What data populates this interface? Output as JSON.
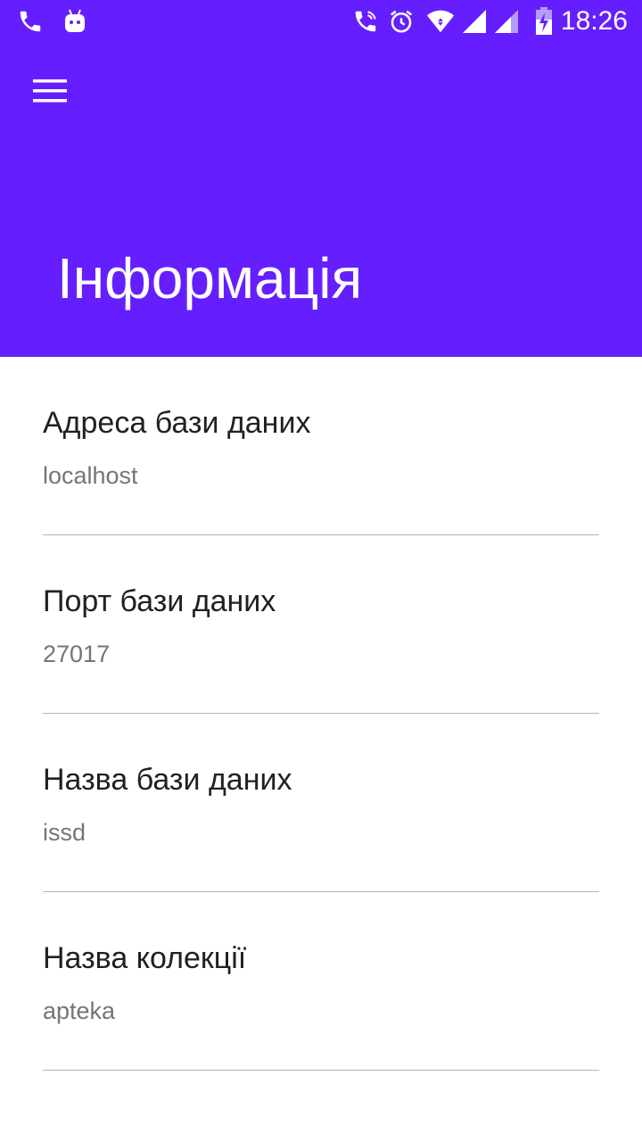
{
  "status_bar": {
    "time": "18:26",
    "icons": [
      "phone-icon",
      "android-notification-icon",
      "wifi-calling-icon",
      "alarm-icon",
      "wifi-icon",
      "cellular-signal-icon",
      "cellular-signal-secondary-icon",
      "battery-charging-icon"
    ]
  },
  "app_bar": {
    "menu_icon": "hamburger-menu-icon",
    "title": "Інформація",
    "color": "#651fff"
  },
  "items": [
    {
      "label": "Адреса бази даних",
      "value": "localhost"
    },
    {
      "label": "Порт бази даних",
      "value": "27017"
    },
    {
      "label": "Назва бази даних",
      "value": "issd"
    },
    {
      "label": "Назва колекції",
      "value": "apteka"
    }
  ]
}
